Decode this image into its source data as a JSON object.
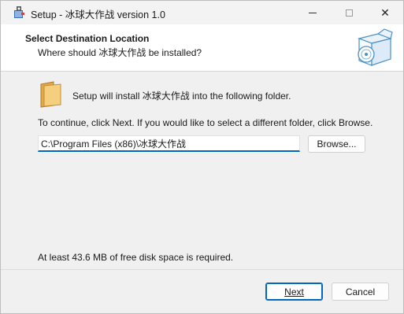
{
  "window": {
    "title": "Setup - 冰球大作战 version 1.0"
  },
  "title_bar_controls": {
    "minimize_icon": "minimize-icon",
    "maximize_icon": "maximize-icon",
    "close_icon": "close-icon",
    "close_glyph": "✕"
  },
  "header": {
    "title": "Select Destination Location",
    "subtitle": "Where should 冰球大作战 be installed?",
    "graphic": "setup-box-disc-icon"
  },
  "body": {
    "install_text": "Setup will install 冰球大作战 into the following folder.",
    "continue_text": "To continue, click Next. If you would like to select a different folder, click Browse.",
    "path_value": "C:\\Program Files (x86)\\冰球大作战",
    "browse_label": "Browse...",
    "disk_space_text": "At least 43.6 MB of free disk space is required."
  },
  "footer": {
    "next_label": "Next",
    "cancel_label": "Cancel"
  },
  "colors": {
    "accent": "#0067c0",
    "header_bg": "#ffffff",
    "body_bg": "#f0f0f0",
    "folder": "#f2c56b"
  }
}
